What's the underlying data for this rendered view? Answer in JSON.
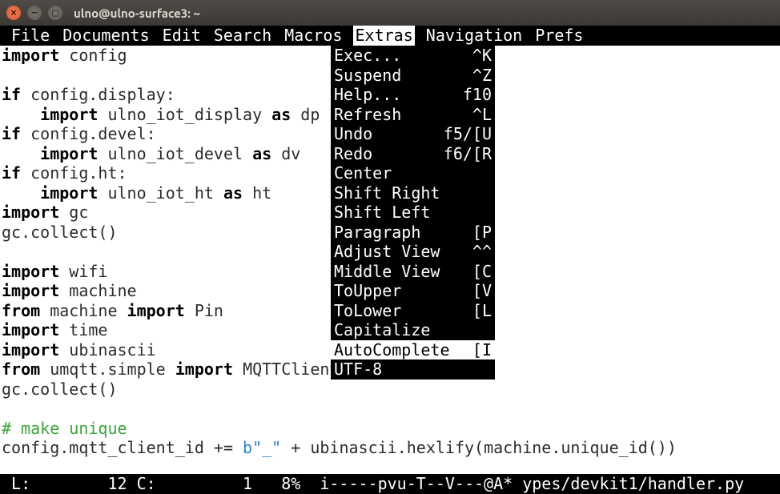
{
  "window": {
    "title": "ulno@ulno-surface3: ~"
  },
  "menubar": {
    "items": [
      " File ",
      "Documents ",
      "Edit ",
      "Search ",
      "Macros ",
      "Extras",
      " Navigation ",
      "Prefs"
    ],
    "active_index": 5
  },
  "code_lines": [
    [
      {
        "t": "import ",
        "c": "kw"
      },
      {
        "t": "config"
      }
    ],
    [],
    [
      {
        "t": "if ",
        "c": "kw"
      },
      {
        "t": "config.display:"
      }
    ],
    [
      {
        "t": "    "
      },
      {
        "t": "import ",
        "c": "kw"
      },
      {
        "t": "ulno_iot_display "
      },
      {
        "t": "as ",
        "c": "kw"
      },
      {
        "t": "dp"
      }
    ],
    [
      {
        "t": "if ",
        "c": "kw"
      },
      {
        "t": "config.devel:"
      }
    ],
    [
      {
        "t": "    "
      },
      {
        "t": "import ",
        "c": "kw"
      },
      {
        "t": "ulno_iot_devel "
      },
      {
        "t": "as ",
        "c": "kw"
      },
      {
        "t": "dv"
      }
    ],
    [
      {
        "t": "if ",
        "c": "kw"
      },
      {
        "t": "config.ht:"
      }
    ],
    [
      {
        "t": "    "
      },
      {
        "t": "import ",
        "c": "kw"
      },
      {
        "t": "ulno_iot_ht "
      },
      {
        "t": "as ",
        "c": "kw"
      },
      {
        "t": "ht"
      }
    ],
    [
      {
        "t": "import ",
        "c": "kw"
      },
      {
        "t": "gc"
      }
    ],
    [
      {
        "t": "gc.collect()"
      }
    ],
    [],
    [
      {
        "t": "import ",
        "c": "kw"
      },
      {
        "t": "wifi"
      }
    ],
    [
      {
        "t": "import ",
        "c": "kw"
      },
      {
        "t": "machine"
      }
    ],
    [
      {
        "t": "from ",
        "c": "kw"
      },
      {
        "t": "machine "
      },
      {
        "t": "import ",
        "c": "kw"
      },
      {
        "t": "Pin"
      }
    ],
    [
      {
        "t": "import ",
        "c": "kw"
      },
      {
        "t": "time"
      }
    ],
    [
      {
        "t": "import ",
        "c": "kw"
      },
      {
        "t": "ubinascii"
      }
    ],
    [
      {
        "t": "from ",
        "c": "kw"
      },
      {
        "t": "umqtt.simple "
      },
      {
        "t": "import ",
        "c": "kw"
      },
      {
        "t": "MQTTClient"
      }
    ],
    [
      {
        "t": "gc.collect()"
      }
    ],
    [],
    [
      {
        "t": "# make unique",
        "c": "cm"
      }
    ],
    [
      {
        "t": "config.mqtt_client_id += "
      },
      {
        "t": "b\"_\"",
        "c": "st"
      },
      {
        "t": " + ubinascii.hexlify(machine.unique_id())"
      }
    ]
  ],
  "dropdown": {
    "rows": [
      {
        "label": "Exec...",
        "key": "^K"
      },
      {
        "label": "Suspend",
        "key": "^Z"
      },
      {
        "label": "Help...",
        "key": "f10"
      },
      {
        "label": "Refresh",
        "key": "^L"
      },
      {
        "label": "Undo",
        "key": "f5/[U"
      },
      {
        "label": "Redo",
        "key": "f6/[R"
      },
      {
        "label": "Center",
        "key": ""
      },
      {
        "label": "Shift Right",
        "key": ""
      },
      {
        "label": "Shift Left",
        "key": ""
      },
      {
        "label": "Paragraph",
        "key": "[P"
      },
      {
        "label": "Adjust View",
        "key": "^^"
      },
      {
        "label": "Middle View",
        "key": "[C"
      },
      {
        "label": "ToUpper",
        "key": "[V"
      },
      {
        "label": "ToLower",
        "key": "[L"
      },
      {
        "label": "Capitalize",
        "key": ""
      },
      {
        "label": "AutoComplete",
        "key": "[I"
      },
      {
        "label": "UTF-8",
        "key": ""
      }
    ],
    "selected_index": 15
  },
  "status": {
    "text": " L:        12 C:         1   8%  i-----pvu-T--V---@A* ypes/devkit1/handler.py "
  }
}
